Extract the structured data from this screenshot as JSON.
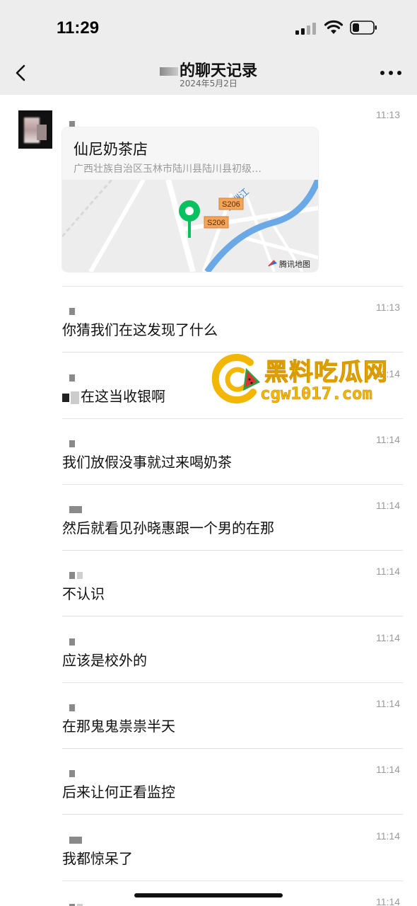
{
  "status": {
    "time": "11:29"
  },
  "nav": {
    "title": "的聊天记录",
    "date": "2024年5月2日"
  },
  "location": {
    "name": "仙尼奶茶店",
    "address": "广西壮族自治区玉林市陆川县陆川县初级…",
    "time": "11:13",
    "road_label_1": "S206",
    "road_label_2": "S206",
    "river_label": "九洲江",
    "map_brand": "腾讯地图"
  },
  "messages": [
    {
      "time": "11:13",
      "text": "你猜我们在这发现了什么"
    },
    {
      "time": "11:14",
      "text": "在这当收银啊"
    },
    {
      "time": "11:14",
      "text": "我们放假没事就过来喝奶茶"
    },
    {
      "time": "11:14",
      "text": "然后就看见孙晓惠跟一个男的在那"
    },
    {
      "time": "11:14",
      "text": "不认识"
    },
    {
      "time": "11:14",
      "text": "应该是校外的"
    },
    {
      "time": "11:14",
      "text": "在那鬼鬼祟祟半天"
    },
    {
      "time": "11:14",
      "text": "后来让何正看监控"
    },
    {
      "time": "11:14",
      "text": "我都惊呆了"
    },
    {
      "time": "11:14",
      "text": ""
    }
  ],
  "watermark": {
    "title": "黑料吃瓜网",
    "url": "cgw1017.com"
  },
  "colors": {
    "header_bg": "#ededed",
    "pin_green": "#07c160",
    "road_orange": "#f3a45a",
    "river_blue": "#6aa9e6",
    "watermark_gold": "#f2b705"
  }
}
